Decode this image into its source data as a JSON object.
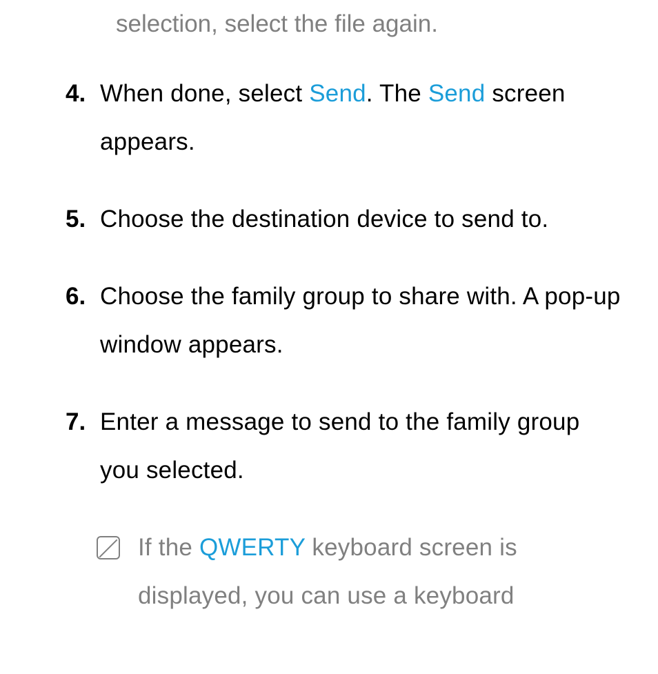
{
  "continuation": {
    "text": "selection, select the file again."
  },
  "items": [
    {
      "number": "4.",
      "parts": [
        {
          "text": "When done, select "
        },
        {
          "text": "Send",
          "style": "blue"
        },
        {
          "text": ". The "
        },
        {
          "text": "Send",
          "style": "blue"
        },
        {
          "text": " screen appears."
        }
      ]
    },
    {
      "number": "5.",
      "parts": [
        {
          "text": "Choose the destination device to send to."
        }
      ]
    },
    {
      "number": "6.",
      "parts": [
        {
          "text": "Choose the family group to share with. A pop-up window appears."
        }
      ]
    },
    {
      "number": "7.",
      "parts": [
        {
          "text": "Enter a message to send to the family group you selected."
        }
      ]
    }
  ],
  "note": {
    "parts": [
      {
        "text": "If the "
      },
      {
        "text": "QWERTY",
        "style": "blue"
      },
      {
        "text": " keyboard screen is displayed, you can use a keyboard"
      }
    ]
  }
}
